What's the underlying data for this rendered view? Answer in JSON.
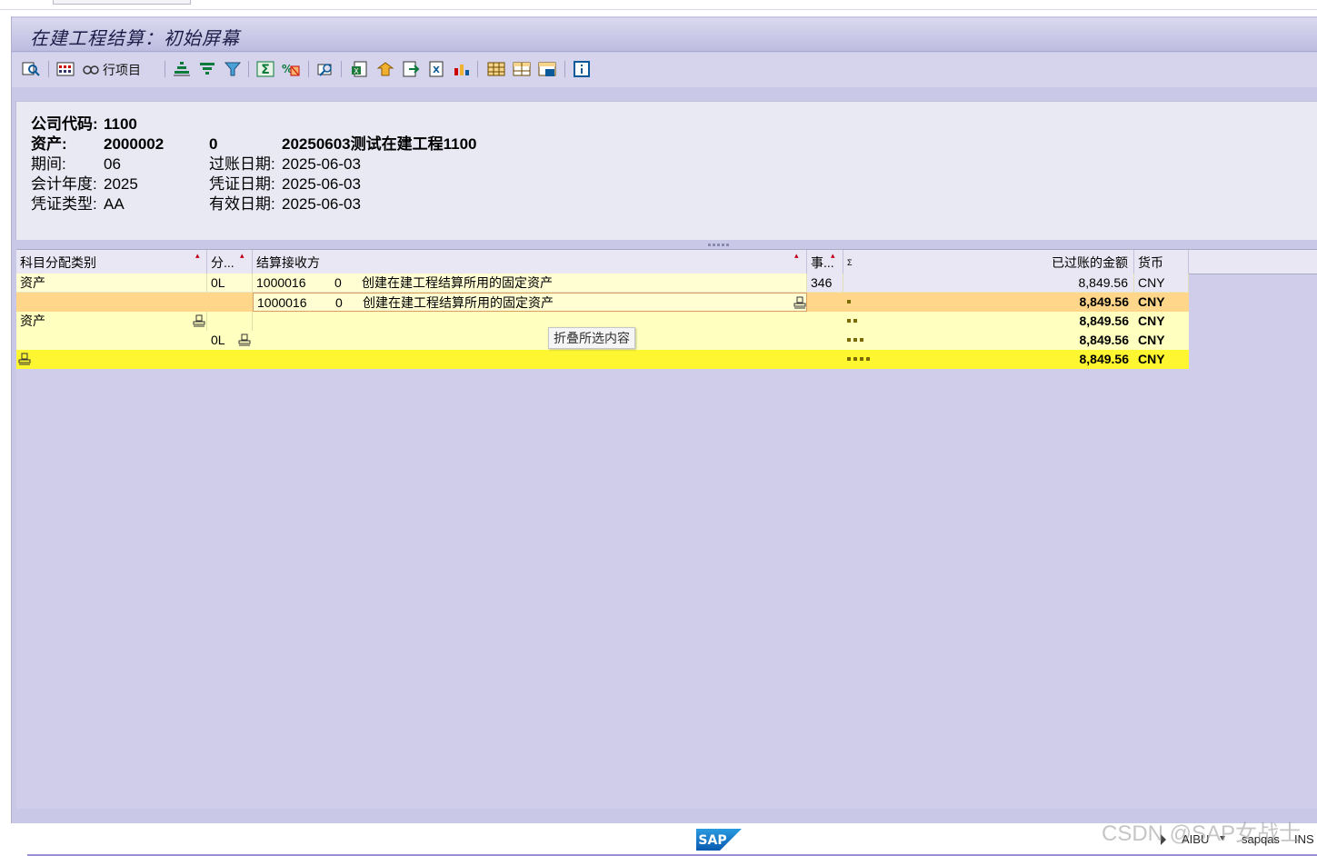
{
  "window": {
    "title": "在建工程结算：初始屏幕"
  },
  "toolbar": {
    "line_items_label": "行项目"
  },
  "header": {
    "company_code_label": "公司代码:",
    "company_code": "1100",
    "asset_label": "资产:",
    "asset_number": "2000002",
    "asset_sub": "0",
    "asset_desc": "20250603测试在建工程1100",
    "period_label": "期间:",
    "period": "06",
    "posting_date_label": "过账日期:",
    "posting_date": "2025-06-03",
    "fiscal_year_label": "会计年度:",
    "fiscal_year": "2025",
    "doc_date_label": "凭证日期:",
    "doc_date": "2025-06-03",
    "doc_type_label": "凭证类型:",
    "doc_type": "AA",
    "value_date_label": "有效日期:",
    "value_date": "2025-06-03"
  },
  "grid": {
    "columns": {
      "acct_assign": "科目分配类别",
      "dist": "分...",
      "receiver": "结算接收方",
      "trans": "事...",
      "sigma": "Σ",
      "amount": "已过账的金额",
      "currency": "货币"
    },
    "rows": [
      {
        "acct_assign": "资产",
        "dist": "0L",
        "receiver_id": "1000016",
        "receiver_sub": "0",
        "receiver_desc": "创建在建工程结算所用的固定资产",
        "trans": "346",
        "amount": "8,849.56",
        "currency": "CNY"
      },
      {
        "receiver_id": "1000016",
        "receiver_sub": "0",
        "receiver_desc": "创建在建工程结算所用的固定资产",
        "amount": "8,849.56",
        "currency": "CNY"
      },
      {
        "acct_assign": "资产",
        "amount": "8,849.56",
        "currency": "CNY"
      },
      {
        "dist": "0L",
        "amount": "8,849.56",
        "currency": "CNY"
      },
      {
        "amount": "8,849.56",
        "currency": "CNY"
      }
    ]
  },
  "tooltip": {
    "text": "折叠所选内容"
  },
  "statusbar": {
    "client": "AIBU",
    "server": "sapqas",
    "mode": "INS"
  },
  "watermark": "CSDN @SAP女战士"
}
